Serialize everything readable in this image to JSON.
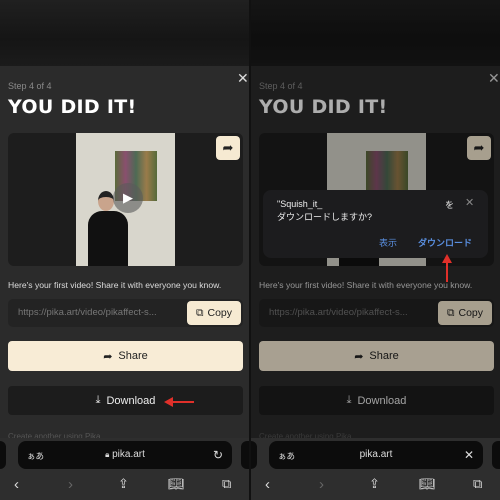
{
  "modal": {
    "step": "Step 4 of 4",
    "title": "YOU DID IT!",
    "description": "Here's your first video! Share it with everyone you know.",
    "url_value": "https://pika.art/video/pikaffect-s...",
    "copy_label": "Copy",
    "share_label": "Share",
    "download_label": "Download",
    "cut_text": "Create another using Pika"
  },
  "dialog": {
    "message_line1": "\"Squish_it_",
    "message_suffix": "を",
    "message_line2": "ダウンロードしますか?",
    "show_label": "表示",
    "download_label": "ダウンロード"
  },
  "browser": {
    "aa": "ぁあ",
    "host": "pika.art"
  },
  "colors": {
    "accent": "#f8ecd6",
    "annotation_arrow": "#e0302a",
    "dialog_link": "#5a8fe0"
  },
  "icons": [
    "close-icon",
    "share-icon",
    "play-icon",
    "copy-icon",
    "download-icon",
    "lock-icon",
    "reload-icon",
    "back-icon",
    "forward-icon",
    "share-sheet-icon",
    "bookmarks-icon",
    "tabs-icon"
  ]
}
